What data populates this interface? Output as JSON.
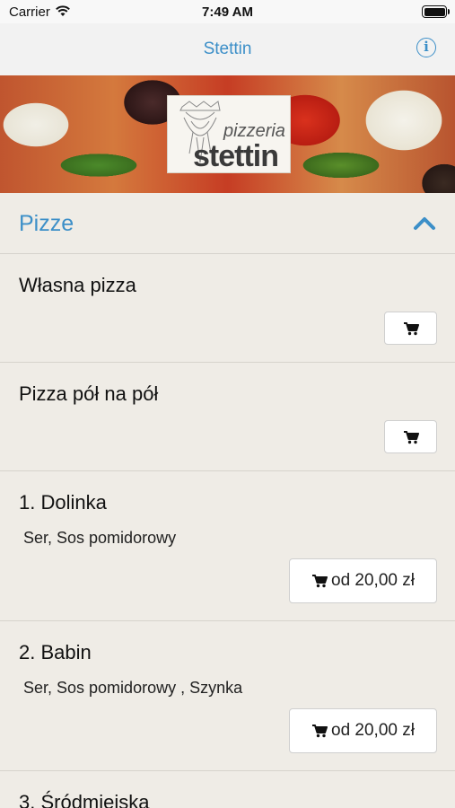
{
  "status": {
    "carrier": "Carrier",
    "time": "7:49 AM"
  },
  "nav": {
    "title": "Stettin"
  },
  "banner": {
    "logo_small": "pizzeria",
    "logo_big": "stettin"
  },
  "section": {
    "title": "Pizze"
  },
  "items": [
    {
      "name": "Własna pizza",
      "desc": "",
      "price": ""
    },
    {
      "name": "Pizza pół na pół",
      "desc": "",
      "price": ""
    },
    {
      "name": "1. Dolinka",
      "desc": "Ser, Sos pomidorowy",
      "price": "od 20,00 zł"
    },
    {
      "name": "2. Babin",
      "desc": "Ser, Sos pomidorowy , Szynka",
      "price": "od 20,00 zł"
    },
    {
      "name": "3. Śródmiejska",
      "desc": "",
      "price": ""
    }
  ],
  "colors": {
    "accent": "#3c8fc8",
    "background": "#efece6"
  },
  "icons": [
    "wifi-icon",
    "battery-icon",
    "info-icon",
    "chevron-up-icon",
    "cart-icon"
  ]
}
